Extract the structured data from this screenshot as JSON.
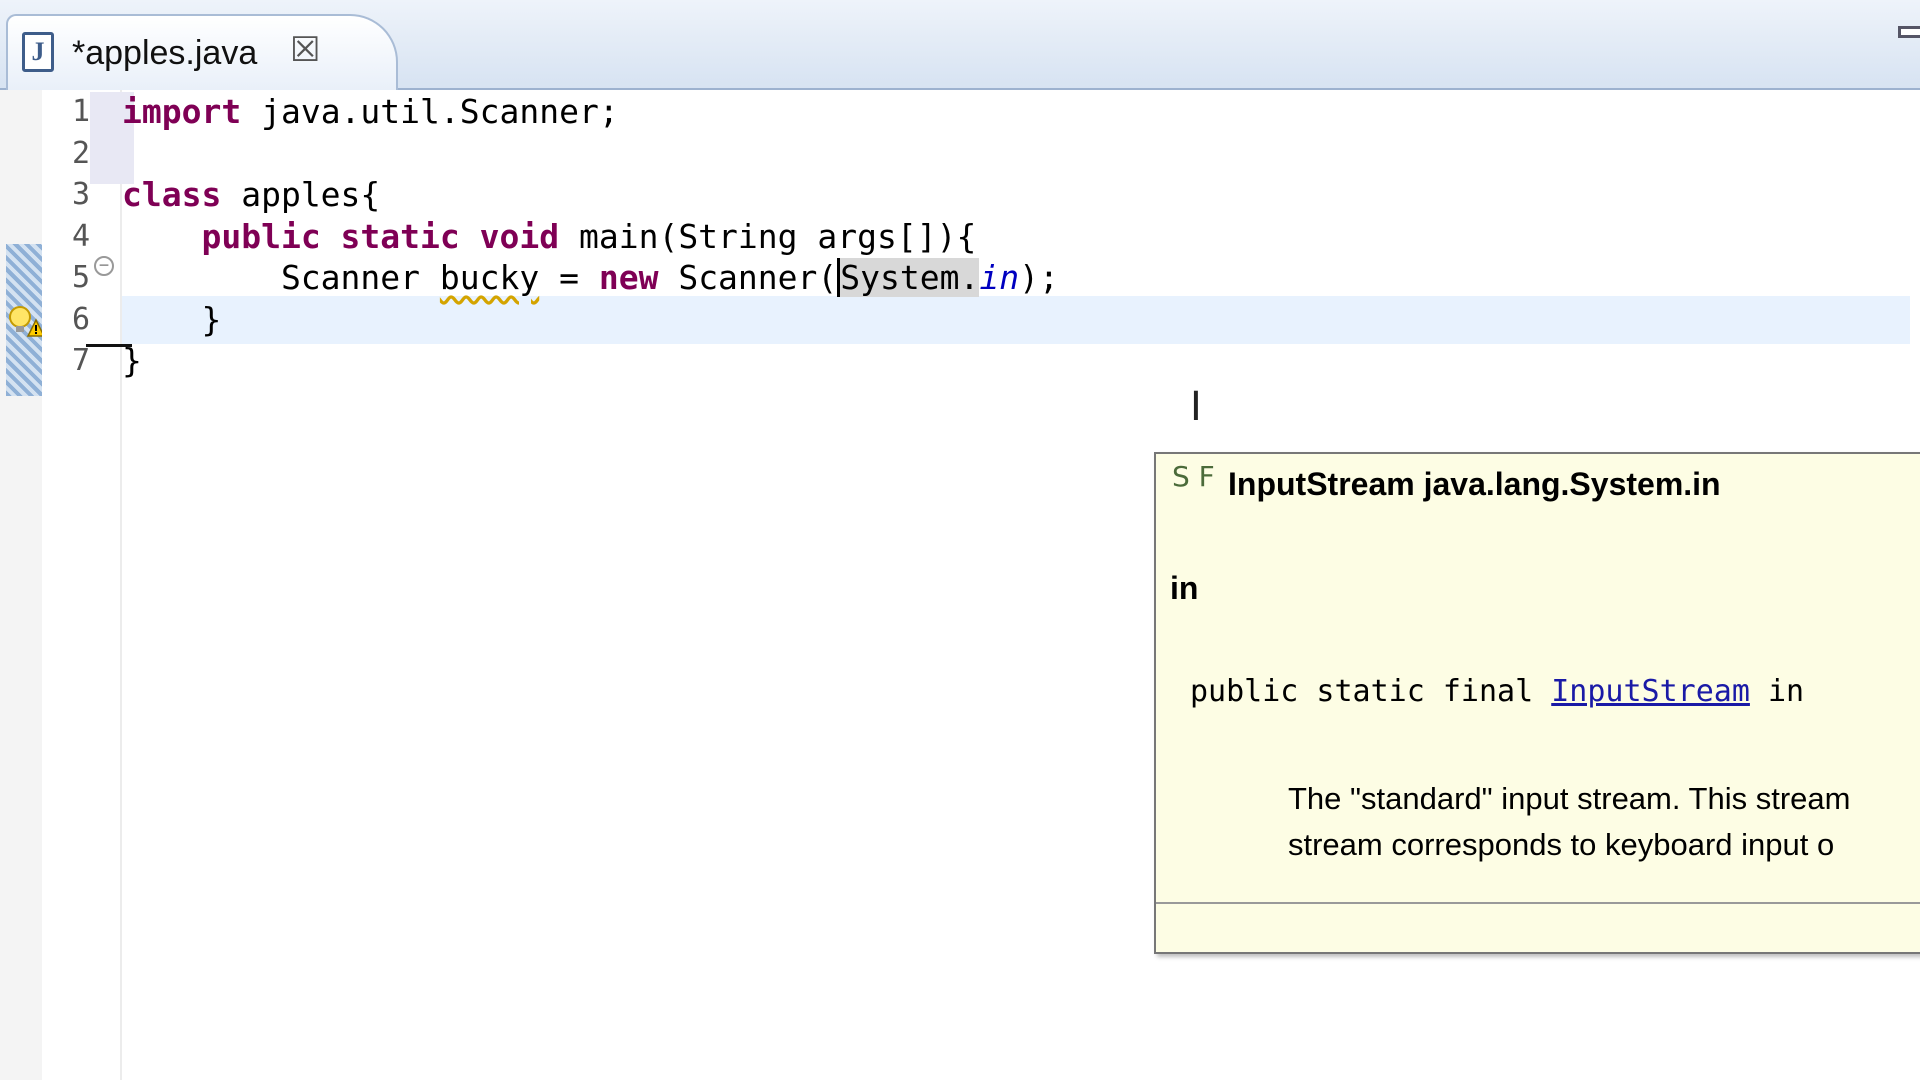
{
  "tab": {
    "label": "*apples.java",
    "icon": "java-file-icon",
    "close_glyph": "☒"
  },
  "gutter": {
    "line_numbers": [
      "1",
      "2",
      "3",
      "4",
      "5",
      "6",
      "7"
    ]
  },
  "code": {
    "lines": [
      [
        {
          "t": "import",
          "k": "kw"
        },
        {
          "t": " java.util.Scanner;"
        }
      ],
      [],
      [
        {
          "t": "class",
          "k": "kw"
        },
        {
          "t": " apples{"
        }
      ],
      [
        {
          "t": "    "
        },
        {
          "t": "public static void",
          "k": "kw"
        },
        {
          "t": " main(String args[]){"
        }
      ],
      [
        {
          "t": "        Scanner "
        },
        {
          "t": "bucky",
          "k": "warn"
        },
        {
          "t": " = "
        },
        {
          "t": "new",
          "k": "kw"
        },
        {
          "t": " Scanner("
        },
        {
          "t": "",
          "k": "caret"
        },
        {
          "t": "System.",
          "k": "sel"
        },
        {
          "t": "in",
          "k": "field"
        },
        {
          "t": ");"
        }
      ],
      [
        {
          "t": "    }"
        }
      ],
      [
        {
          "t": "}"
        }
      ]
    ]
  },
  "popup": {
    "icon_text": "S F",
    "header": "InputStream java.lang.System.in",
    "name": "in",
    "sig_prefix": "public static final ",
    "sig_link": "InputStream",
    "sig_suffix": " in",
    "desc_line1": "The \"standard\" input stream. This stream",
    "desc_line2": "stream corresponds to keyboard input o"
  },
  "colors": {
    "keyword": "#7f0055",
    "field": "#0000c0",
    "popup_bg": "#fdfde4",
    "current_line": "#e8f2fe"
  }
}
